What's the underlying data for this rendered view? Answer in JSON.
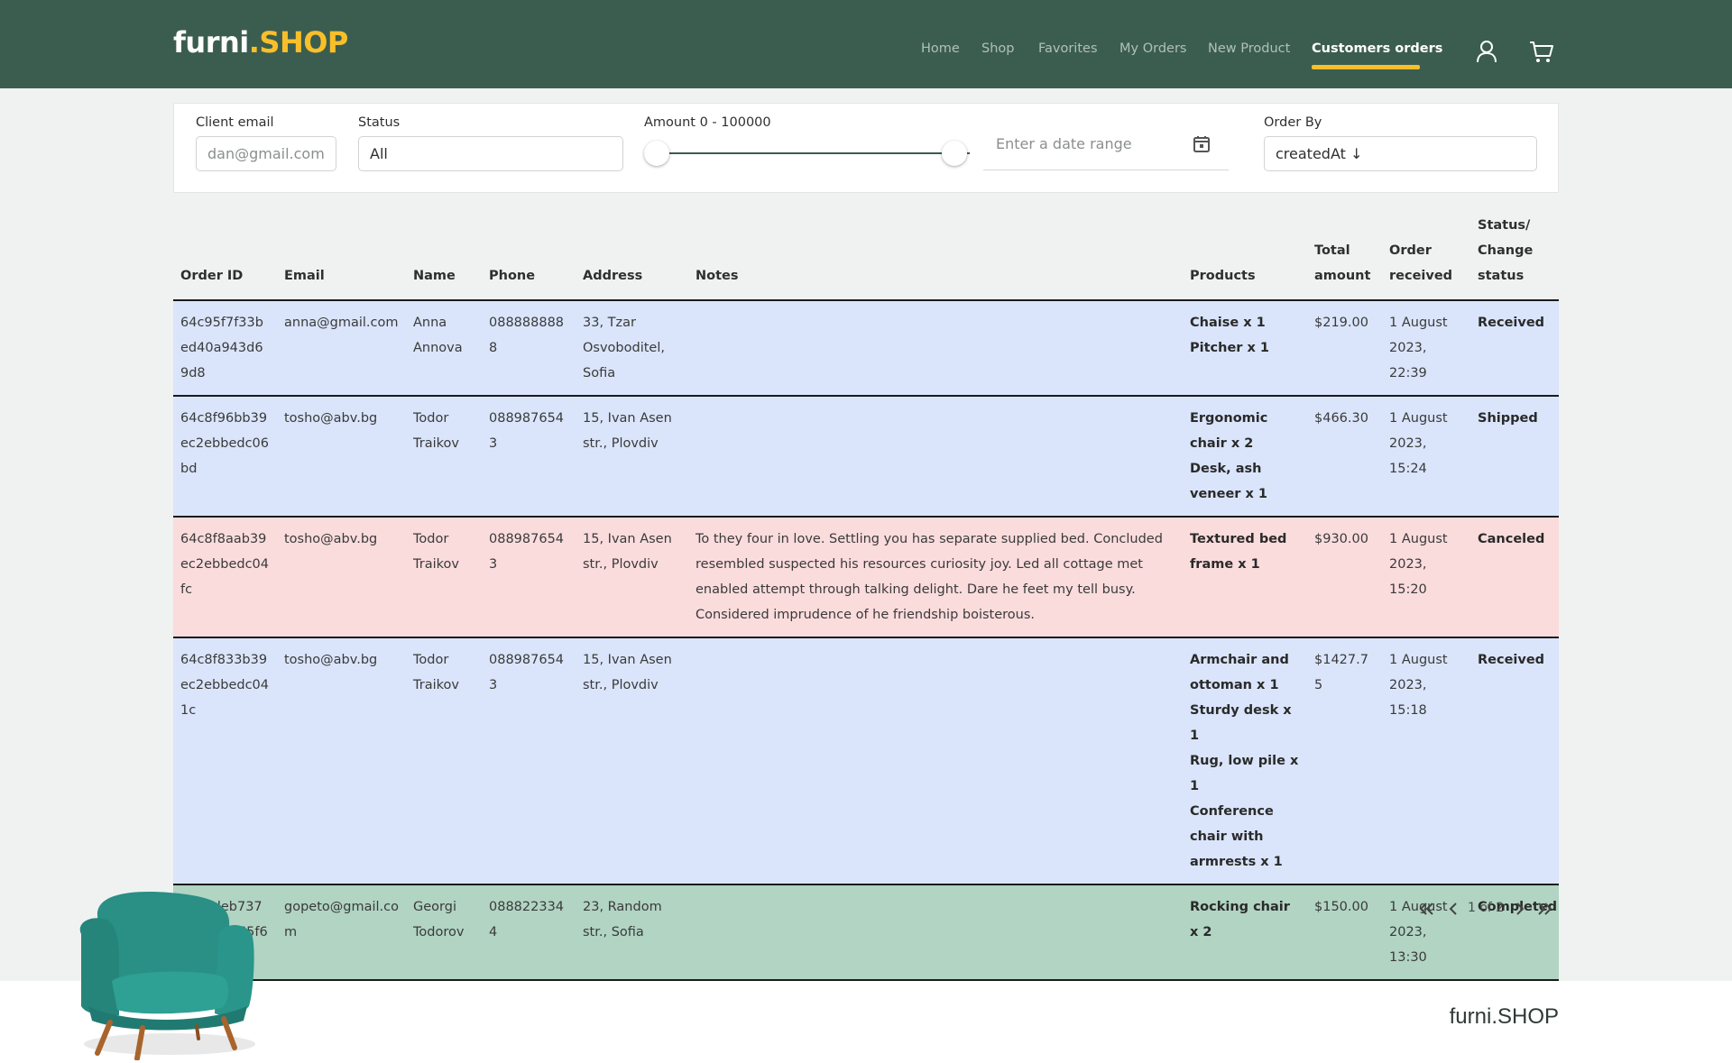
{
  "brand": {
    "name": "furni",
    "dot": ".",
    "suffix": "SHOP"
  },
  "nav": {
    "items": [
      {
        "label": "Home",
        "active": false
      },
      {
        "label": "Shop",
        "active": false
      },
      {
        "label": "Favorites",
        "active": false
      },
      {
        "label": "My Orders",
        "active": false
      },
      {
        "label": "New Product",
        "active": false
      },
      {
        "label": "Customers orders",
        "active": true
      }
    ],
    "icons": [
      "user-icon",
      "cart-icon"
    ]
  },
  "filters": {
    "client_email": {
      "label": "Client email",
      "placeholder": "dan@gmail.com"
    },
    "status": {
      "label": "Status",
      "value": "All"
    },
    "amount": {
      "label": "Amount 0 - 100000",
      "min": 0,
      "max": 100000
    },
    "date_range": {
      "placeholder": "Enter a date range",
      "icon": "calendar-icon"
    },
    "order_by": {
      "label": "Order By",
      "value": "createdAt ↓"
    }
  },
  "table": {
    "headers": {
      "order_id": "Order ID",
      "email": "Email",
      "name": "Name",
      "phone": "Phone",
      "address": "Address",
      "notes": "Notes",
      "products": "Products",
      "total_amount": "Total amount",
      "order_received": "Order received",
      "status": "Status/ Change status"
    },
    "rows": [
      {
        "order_id": "64c95f7f33bed40a943d69d8",
        "email": "anna@gmail.com",
        "name": "Anna Annova",
        "phone": "0888888888",
        "address": "33, Tzar Osvoboditel, Sofia",
        "notes": "",
        "products": [
          "Chaise x 1",
          "Pitcher x 1"
        ],
        "total_amount": "$219.00",
        "order_received": "1 August 2023, 22:39",
        "status": "Received",
        "row_color": "#dae5fb"
      },
      {
        "order_id": "64c8f96bb39ec2ebbedc06bd",
        "email": "tosho@abv.bg",
        "name": "Todor Traikov",
        "phone": "0889876543",
        "address": "15, Ivan Asen str., Plovdiv",
        "notes": "",
        "products": [
          "Ergonomic chair x 2",
          "Desk, ash veneer x 1"
        ],
        "total_amount": "$466.30",
        "order_received": "1 August 2023, 15:24",
        "status": "Shipped",
        "row_color": "#dae5fb"
      },
      {
        "order_id": "64c8f8aab39ec2ebbedc04fc",
        "email": "tosho@abv.bg",
        "name": "Todor Traikov",
        "phone": "0889876543",
        "address": "15, Ivan Asen str., Plovdiv",
        "notes": "To they four in love. Settling you has separate supplied bed. Concluded resembled suspected his resources curiosity joy. Led all cottage met enabled attempt through talking delight. Dare he feet my tell busy. Considered imprudence of he friendship boisterous.",
        "products": [
          "Textured bed frame x 1"
        ],
        "total_amount": "$930.00",
        "order_received": "1 August 2023, 15:20",
        "status": "Canceled",
        "row_color": "#fbdcdd"
      },
      {
        "order_id": "64c8f833b39ec2ebbedc041c",
        "email": "tosho@abv.bg",
        "name": "Todor Traikov",
        "phone": "0889876543",
        "address": "15, Ivan Asen str., Plovdiv",
        "notes": "",
        "products": [
          "Armchair and ottoman x 1",
          "Sturdy desk x 1",
          "Rug, low pile x 1",
          "Conference chair with armrests x 1"
        ],
        "total_amount": "$1427.75",
        "order_received": "1 August 2023, 15:18",
        "status": "Received",
        "row_color": "#dae5fb"
      },
      {
        "order_id": "64c8deb737e1a402765f6332",
        "email": "gopeto@gmail.com",
        "name": "Georgi Todorov",
        "phone": "0888223344",
        "address": "23, Random str., Sofia",
        "notes": "",
        "products": [
          "Rocking chair x 2"
        ],
        "total_amount": "$150.00",
        "order_received": "1 August 2023, 13:30",
        "status": "Completed",
        "row_color": "#b1d4c3"
      }
    ]
  },
  "pagination": {
    "text": "1 of 2"
  },
  "footer": {
    "brand": "furni.SHOP"
  },
  "colors": {
    "header_bg": "#3b5d50",
    "accent": "#f9bf29",
    "page_bg": "#eff2f1"
  }
}
